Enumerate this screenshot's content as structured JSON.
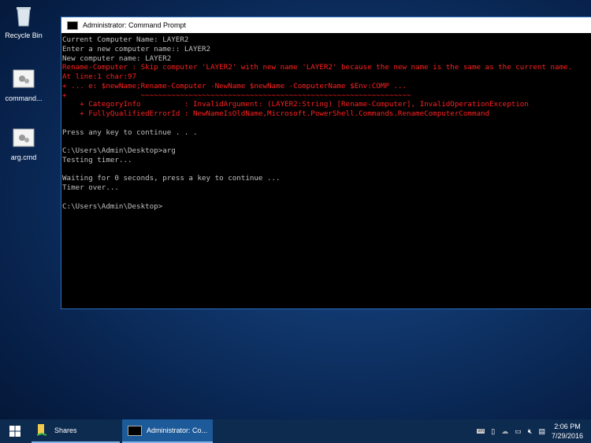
{
  "desktop": {
    "icons": [
      {
        "label": "Recycle Bin"
      },
      {
        "label": "command..."
      },
      {
        "label": "arg.cmd"
      }
    ]
  },
  "window": {
    "title": "Administrator: Command Prompt",
    "lines": [
      {
        "text": "Current Computer Name: LAYER2",
        "error": false
      },
      {
        "text": "Enter a new computer name:: LAYER2",
        "error": false
      },
      {
        "text": "New computer name: LAYER2",
        "error": false
      },
      {
        "text": "Rename-Computer : Skip computer 'LAYER2' with new name 'LAYER2' because the new name is the same as the current name.",
        "error": true
      },
      {
        "text": "At line:1 char:97",
        "error": true
      },
      {
        "text": "+ ... e: $newName;Rename-Computer -NewName $newName -ComputerName $Env:COMP ...",
        "error": true
      },
      {
        "text": "+                 ~~~~~~~~~~~~~~~~~~~~~~~~~~~~~~~~~~~~~~~~~~~~~~~~~~~~~~~~~~~~~~",
        "error": true
      },
      {
        "text": "    + CategoryInfo          : InvalidArgument: (LAYER2:String) [Rename-Computer], InvalidOperationException",
        "error": true
      },
      {
        "text": "    + FullyQualifiedErrorId : NewNameIsOldName,Microsoft.PowerShell.Commands.RenameComputerCommand",
        "error": true
      },
      {
        "text": "",
        "error": false
      },
      {
        "text": "Press any key to continue . . .",
        "error": false
      },
      {
        "text": "",
        "error": false
      },
      {
        "text": "C:\\Users\\Admin\\Desktop>arg",
        "error": false
      },
      {
        "text": "Testing timer...",
        "error": false
      },
      {
        "text": "",
        "error": false
      },
      {
        "text": "Waiting for 0 seconds, press a key to continue ...",
        "error": false
      },
      {
        "text": "Timer over...",
        "error": false
      },
      {
        "text": "",
        "error": false
      },
      {
        "text": "C:\\Users\\Admin\\Desktop>",
        "error": false
      }
    ]
  },
  "taskbar": {
    "items": [
      {
        "label": "Shares"
      },
      {
        "label": "Administrator: Co..."
      }
    ],
    "tray": {
      "time": "2:06 PM",
      "date": "7/29/2016"
    }
  }
}
